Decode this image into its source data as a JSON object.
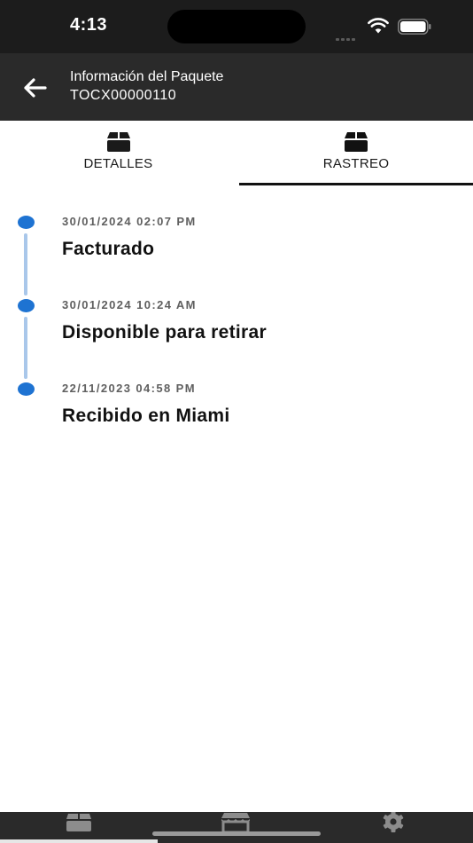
{
  "status_bar": {
    "time": "4:13"
  },
  "header": {
    "title": "Información del Paquete",
    "subtitle": "TOCX00000110",
    "back_icon": "arrow-left-icon"
  },
  "tabs": [
    {
      "label": "DETALLES",
      "icon": "package-icon",
      "active": false
    },
    {
      "label": "RASTREO",
      "icon": "package-icon",
      "active": true
    }
  ],
  "timeline": {
    "events": [
      {
        "date": "30/01/2024 02:07 PM",
        "status": "Facturado"
      },
      {
        "date": "30/01/2024 10:24 AM",
        "status": "Disponible para retirar"
      },
      {
        "date": "22/11/2023 04:58 PM",
        "status": "Recibido en Miami"
      }
    ]
  },
  "bottom_nav": {
    "items": [
      {
        "icon": "package-icon",
        "active": true
      },
      {
        "icon": "store-icon",
        "active": false
      },
      {
        "icon": "gear-icon",
        "active": false
      }
    ]
  },
  "colors": {
    "status_bar_bg": "#1c1c1c",
    "header_bg": "#2a2a2a",
    "timeline_dot": "#1e73d2",
    "timeline_line": "#a9c7ea",
    "tab_indicator": "#111111"
  }
}
